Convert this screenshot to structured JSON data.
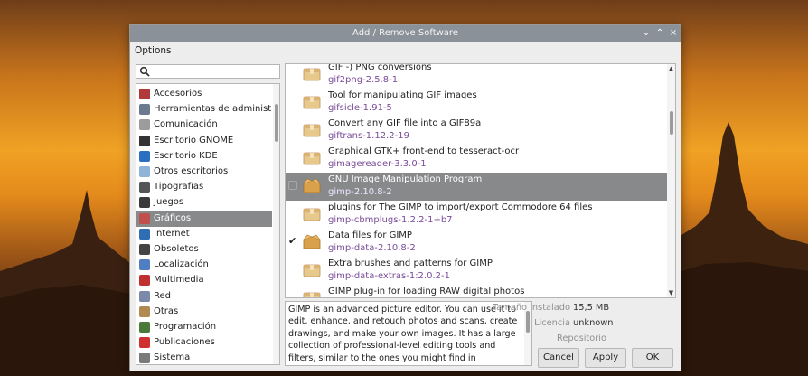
{
  "window": {
    "title": "Add / Remove Software",
    "controls": {
      "minimize": "⌄",
      "maximize": "⌃",
      "close": "×"
    }
  },
  "menu": {
    "options": "Options"
  },
  "search": {
    "placeholder": "",
    "value": ""
  },
  "categories": [
    {
      "label": "Accesorios",
      "icon": "accessories-icon",
      "color": "#b03a3a"
    },
    {
      "label": "Herramientas de administración",
      "icon": "admin-tools-icon",
      "color": "#6b7a8f"
    },
    {
      "label": "Comunicación",
      "icon": "communication-icon",
      "color": "#9c9c9c"
    },
    {
      "label": "Escritorio GNOME",
      "icon": "gnome-icon",
      "color": "#333333"
    },
    {
      "label": "Escritorio KDE",
      "icon": "kde-icon",
      "color": "#2b6fc2"
    },
    {
      "label": "Otros escritorios",
      "icon": "desktops-icon",
      "color": "#8fb3d9"
    },
    {
      "label": "Tipografías",
      "icon": "fonts-icon",
      "color": "#555555"
    },
    {
      "label": "Juegos",
      "icon": "games-icon",
      "color": "#3a3a3a"
    },
    {
      "label": "Gráficos",
      "icon": "graphics-icon",
      "color": "#c0504d"
    },
    {
      "label": "Internet",
      "icon": "internet-icon",
      "color": "#2f6db5"
    },
    {
      "label": "Obsoletos",
      "icon": "obsolete-icon",
      "color": "#444444"
    },
    {
      "label": "Localización",
      "icon": "localization-icon",
      "color": "#4f7fc2"
    },
    {
      "label": "Multimedia",
      "icon": "multimedia-icon",
      "color": "#c03030"
    },
    {
      "label": "Red",
      "icon": "network-icon",
      "color": "#7a8aa8"
    },
    {
      "label": "Otras",
      "icon": "other-icon",
      "color": "#b08a50"
    },
    {
      "label": "Programación",
      "icon": "programming-icon",
      "color": "#4a7a3a"
    },
    {
      "label": "Publicaciones",
      "icon": "publishing-icon",
      "color": "#d03030"
    },
    {
      "label": "Sistema",
      "icon": "system-icon",
      "color": "#7a7a7a"
    }
  ],
  "selected_category": "Gráficos",
  "packages": [
    {
      "desc": "GIF -) PNG conversions",
      "name": "gif2png-2.5.8-1",
      "checked": false,
      "icon": "package-icon"
    },
    {
      "desc": "Tool for manipulating GIF images",
      "name": "gifsicle-1.91-5",
      "checked": false,
      "icon": "package-icon"
    },
    {
      "desc": "Convert any GIF file into a GIF89a",
      "name": "giftrans-1.12.2-19",
      "checked": false,
      "icon": "package-icon"
    },
    {
      "desc": "Graphical GTK+ front-end to tesseract-ocr",
      "name": "gimagereader-3.3.0-1",
      "checked": false,
      "icon": "package-icon"
    },
    {
      "desc": "GNU Image Manipulation Program",
      "name": "gimp-2.10.8-2",
      "checked": false,
      "icon": "gimp-package-icon",
      "selected": true
    },
    {
      "desc": "plugins for The GIMP to import/export Commodore 64 files",
      "name": "gimp-cbmplugs-1.2.2-1+b7",
      "checked": false,
      "icon": "package-icon"
    },
    {
      "desc": "Data files for GIMP",
      "name": "gimp-data-2.10.8-2",
      "checked": true,
      "icon": "open-package-icon"
    },
    {
      "desc": "Extra brushes and patterns for GIMP",
      "name": "gimp-data-extras-1:2.0.2-1",
      "checked": false,
      "icon": "package-icon"
    },
    {
      "desc": "GIMP plug-in for loading RAW digital photos",
      "name": "",
      "checked": false,
      "icon": "package-icon"
    }
  ],
  "description": "GIMP is an advanced picture editor. You can use it to edit, enhance, and retouch photos and scans, create drawings, and make your own images. It has a large collection of professional-level editing tools and filters, similar to the ones you might find in Photoshop. Numerous fine-control settings",
  "details": {
    "installed_size_label": "Tamaño instalado",
    "installed_size_value": "15,5 MB",
    "license_label": "Licencia",
    "license_value": "unknown",
    "repository_label": "Repositorio",
    "repository_value": ""
  },
  "buttons": {
    "cancel": "Cancel",
    "apply": "Apply",
    "ok": "OK"
  },
  "colors": {
    "titlebar": "#8a9199",
    "selection": "#87898b",
    "package_name": "#7a4c9a"
  }
}
